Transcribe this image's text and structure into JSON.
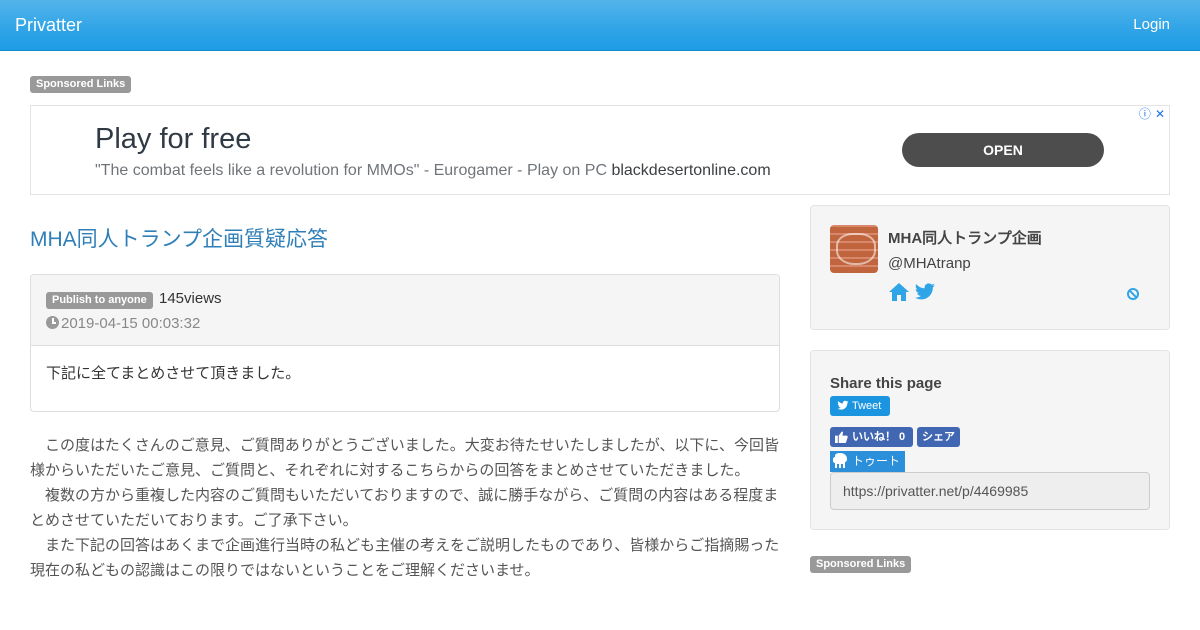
{
  "navbar": {
    "brand": "Privatter",
    "login": "Login"
  },
  "sponsored": {
    "label": "Sponsored Links"
  },
  "ad": {
    "title": "Play for free",
    "subtitle": "\"The combat feels like a revolution for MMOs\" - Eurogamer - Play on PC",
    "domain": "blackdesertonline.com",
    "cta": "OPEN",
    "info_glyph": "ⓘ",
    "close_glyph": "✕"
  },
  "post": {
    "title": "MHA同人トランプ企画質疑応答",
    "visibility": "Publish to anyone",
    "views": "145views",
    "date": "2019-04-15 00:03:32",
    "summary": "下記に全てまとめさせて頂きました。",
    "paragraphs": [
      "　この度はたくさんのご意見、ご質問ありがとうございました。大変お待たせいたしましたが、以下に、今回皆様からいただいたご意見、ご質問と、それぞれに対するこちらからの回答をまとめさせていただきました。",
      "　複数の方から重複した内容のご質問もいただいておりますので、誠に勝手ながら、ご質問の内容はある程度まとめさせていただいております。ご了承下さい。",
      "　また下記の回答はあくまで企画進行当時の私ども主催の考えをご説明したものであり、皆様からご指摘賜った現在の私どもの認識はこの限りではないということをご理解くださいませ。"
    ]
  },
  "profile": {
    "name": "MHA同人トランプ企画",
    "handle": "@MHAtranp",
    "icons": [
      "home-icon",
      "twitter-icon",
      "ban-icon"
    ]
  },
  "share": {
    "title": "Share this page",
    "tweet": "Tweet",
    "like": "いいね！ 0",
    "fb_share": "シェア",
    "toot": "トゥート",
    "url": "https://privatter.net/p/4469985"
  },
  "colors": {
    "navbar": "#2fa4e7",
    "title_link": "#2f7fb8",
    "label_gray": "#999999",
    "ad_button": "#4d4d4d",
    "twitter": "#1b95e0",
    "facebook": "#4267b2",
    "mastodon": "#2b90d9"
  }
}
